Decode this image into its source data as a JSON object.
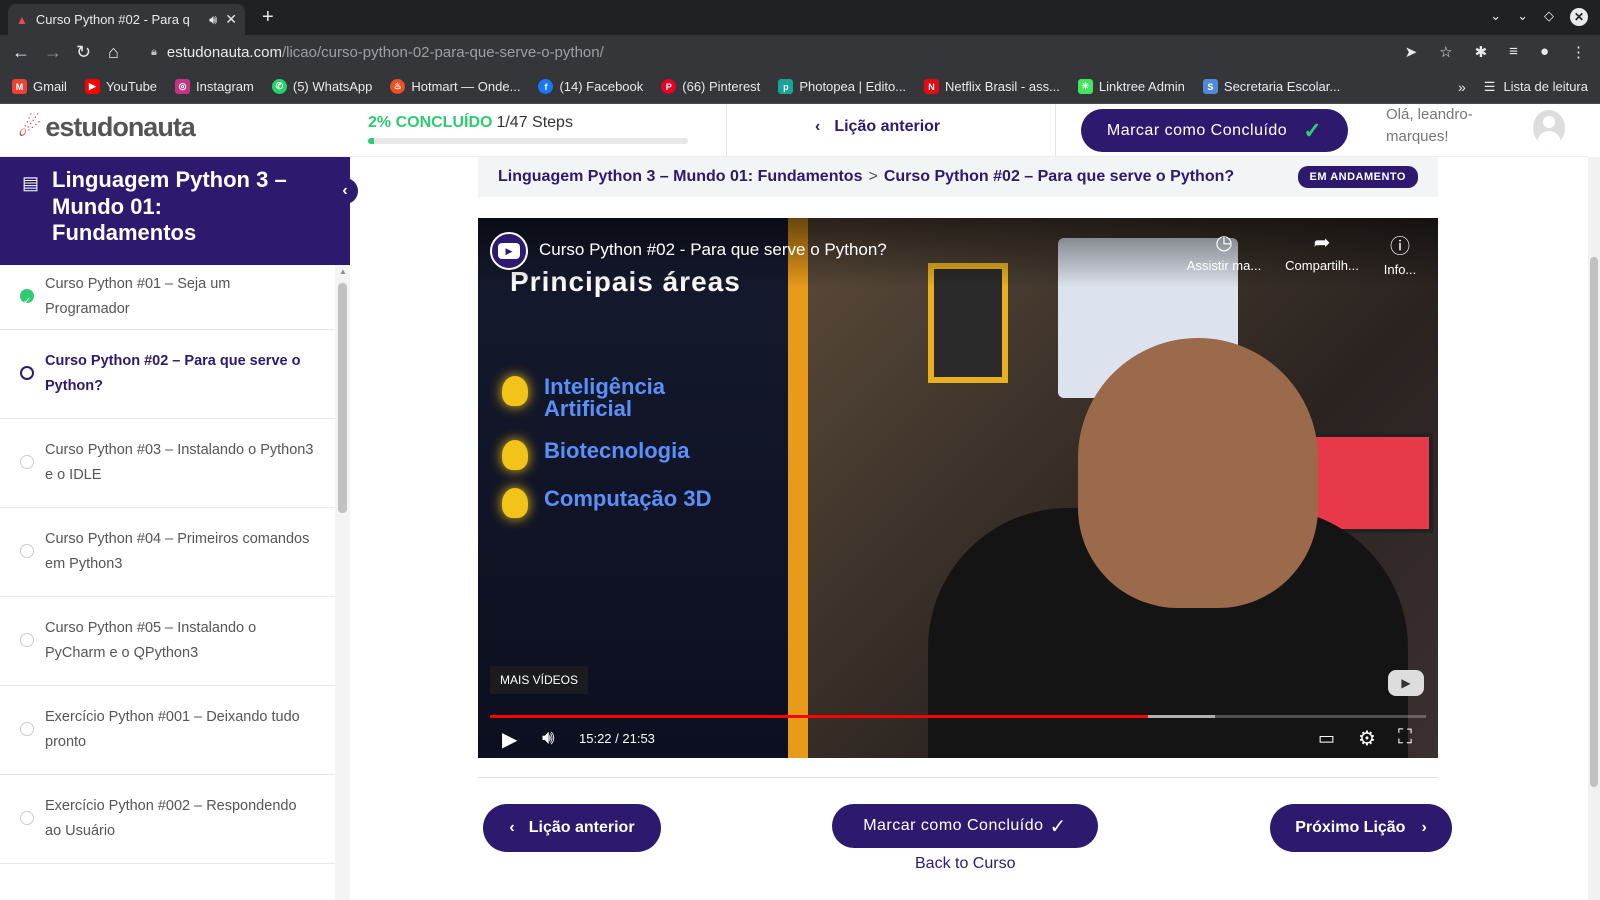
{
  "browser": {
    "tab_title": "Curso Python #02 - Para q",
    "tab_audio_icon": "speaker-icon",
    "url_domain": "estudonauta.com",
    "url_path": "/licao/curso-python-02-para-que-serve-o-python/",
    "bookmarks": [
      {
        "label": "Gmail",
        "icon": "gmail-icon",
        "color": "#ea4335"
      },
      {
        "label": "YouTube",
        "icon": "youtube-icon",
        "color": "#ff0000"
      },
      {
        "label": "Instagram",
        "icon": "instagram-icon",
        "color": "#c13584"
      },
      {
        "label": "(5) WhatsApp",
        "icon": "whatsapp-icon",
        "color": "#25d366"
      },
      {
        "label": "Hotmart — Onde...",
        "icon": "hotmart-icon",
        "color": "#f04e23"
      },
      {
        "label": "(14) Facebook",
        "icon": "facebook-icon",
        "color": "#1877f2"
      },
      {
        "label": "(66) Pinterest",
        "icon": "pinterest-icon",
        "color": "#e60023"
      },
      {
        "label": "Photopea | Edito...",
        "icon": "photopea-icon",
        "color": "#18a497"
      },
      {
        "label": "Netflix Brasil - ass...",
        "icon": "netflix-icon",
        "color": "#e50914"
      },
      {
        "label": "Linktree Admin",
        "icon": "linktree-icon",
        "color": "#43e55e"
      },
      {
        "label": "Secretaria Escolar...",
        "icon": "secretaria-icon",
        "color": "#4f8bd6"
      }
    ],
    "bookmarks_more": "»",
    "reading_list": "Lista de leitura"
  },
  "header": {
    "logo_text": "estudonauta",
    "progress_pct": "2% CONCLUÍDO",
    "progress_steps": "1/47 Steps",
    "progress_fraction": 0.02,
    "prev_label": "Lição anterior",
    "mark_label": "Marcar como Concluído",
    "greeting": "Olá, leandro-marques!"
  },
  "sidebar": {
    "title": "Linguagem Python 3 – Mundo 01: Fundamentos",
    "items": [
      {
        "label": "Curso Python #01 – Seja um Programador",
        "status": "done"
      },
      {
        "label": "Curso Python #02 – Para que serve o Python?",
        "status": "current"
      },
      {
        "label": "Curso Python #03 – Instalando o Python3 e o IDLE",
        "status": "todo"
      },
      {
        "label": "Curso Python #04 – Primeiros comandos em Python3",
        "status": "todo"
      },
      {
        "label": "Curso Python #05 – Instalando o PyCharm e o QPython3",
        "status": "todo"
      },
      {
        "label": "Exercício Python #001 – Deixando tudo pronto",
        "status": "todo"
      },
      {
        "label": "Exercício Python #002 – Respondendo ao Usuário",
        "status": "todo"
      }
    ]
  },
  "breadcrumb": {
    "course": "Linguagem Python 3 – Mundo 01: Fundamentos",
    "separator": ">",
    "lesson": "Curso Python #02 – Para que serve o Python?",
    "status_badge": "EM ANDAMENTO"
  },
  "video": {
    "title": "Curso Python #02 - Para que serve o Python?",
    "actions": [
      {
        "label": "Assistir ma...",
        "icon": "clock-icon"
      },
      {
        "label": "Compartilh...",
        "icon": "share-icon"
      },
      {
        "label": "Info...",
        "icon": "info-icon"
      }
    ],
    "slide_heading": "Principais áreas",
    "slide_items": [
      "Inteligência Artificial",
      "Biotecnologia",
      "Computação 3D"
    ],
    "more_videos": "MAIS VÍDEOS",
    "time": "15:22 / 21:53",
    "played_fraction": 0.7027,
    "buffered_fraction": 0.775
  },
  "bottom_nav": {
    "prev_label": "Lição anterior",
    "mark_label": "Marcar como Concluído",
    "next_label": "Próximo Lição",
    "back_link": "Back to Curso"
  },
  "colors": {
    "brand_purple": "#2d1a6e",
    "success_green": "#2ecc71",
    "logo_red": "#e52d3a"
  }
}
